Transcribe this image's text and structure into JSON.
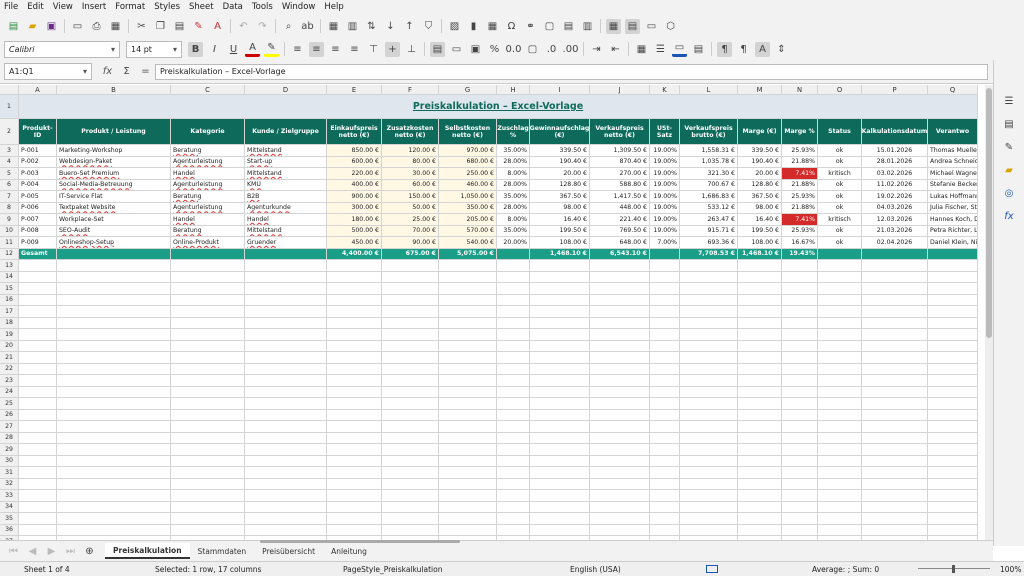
{
  "menu": [
    "File",
    "Edit",
    "View",
    "Insert",
    "Format",
    "Styles",
    "Sheet",
    "Data",
    "Tools",
    "Window",
    "Help"
  ],
  "toolbar": {
    "font_name": "Calibri",
    "font_size": "14 pt"
  },
  "formula_bar": {
    "name_box": "A1:Q1",
    "fx": "fx",
    "sigma": "Σ",
    "eq": "=",
    "content": "Preiskalkulation – Excel-Vorlage"
  },
  "columns": [
    "A",
    "B",
    "C",
    "D",
    "E",
    "F",
    "G",
    "H",
    "I",
    "J",
    "K",
    "L",
    "M",
    "N",
    "O",
    "P",
    "Q"
  ],
  "title": "Preiskalkulation – Excel-Vorlage",
  "headers": [
    "Produkt-ID",
    "Produkt / Leistung",
    "Kategorie",
    "Kunde / Zielgruppe",
    "Einkaufspreis netto (€)",
    "Zusatzkosten netto (€)",
    "Selbstkosten netto (€)",
    "Zuschlag %",
    "Gewinnaufschlag (€)",
    "Verkaufspreis netto (€)",
    "USt-Satz",
    "Verkaufspreis brutto (€)",
    "Marge (€)",
    "Marge %",
    "Status",
    "Kalkulationsdatum",
    "Verantwo"
  ],
  "rows": [
    [
      "P-001",
      "Marketing-Workshop",
      "Beratung",
      "Mittelstand",
      "850.00 €",
      "120.00 €",
      "970.00 €",
      "35.00%",
      "339.50 €",
      "1,309.50 €",
      "19.00%",
      "1,558.31 €",
      "339.50 €",
      "25.93%",
      "ok",
      "15.01.2026",
      "Thomas Mueller"
    ],
    [
      "P-002",
      "Webdesign-Paket",
      "Agenturleistung",
      "Start-up",
      "600.00 €",
      "80.00 €",
      "680.00 €",
      "28.00%",
      "190.40 €",
      "870.40 €",
      "19.00%",
      "1,035.78 €",
      "190.40 €",
      "21.88%",
      "ok",
      "28.01.2026",
      "Andrea Schneid"
    ],
    [
      "P-003",
      "Buero-Set Premium",
      "Handel",
      "Mittelstand",
      "220.00 €",
      "30.00 €",
      "250.00 €",
      "8.00%",
      "20.00 €",
      "270.00 €",
      "19.00%",
      "321.30 €",
      "20.00 €",
      "7.41%",
      "kritisch",
      "03.02.2026",
      "Michael Wagne"
    ],
    [
      "P-004",
      "Social-Media-Betreuung",
      "Agenturleistung",
      "KMU",
      "400.00 €",
      "60.00 €",
      "460.00 €",
      "28.00%",
      "128.80 €",
      "588.80 €",
      "19.00%",
      "700.67 €",
      "128.80 €",
      "21.88%",
      "ok",
      "11.02.2026",
      "Stefanie Becker"
    ],
    [
      "P-005",
      "IT-Service Flat",
      "Beratung",
      "B2B",
      "900.00 €",
      "150.00 €",
      "1,050.00 €",
      "35.00%",
      "367.50 €",
      "1,417.50 €",
      "19.00%",
      "1,686.83 €",
      "367.50 €",
      "25.93%",
      "ok",
      "19.02.2026",
      "Lukas Hoffmann"
    ],
    [
      "P-006",
      "Textpaket Website",
      "Agenturleistung",
      "Agenturkunde",
      "300.00 €",
      "50.00 €",
      "350.00 €",
      "28.00%",
      "98.00 €",
      "448.00 €",
      "19.00%",
      "533.12 €",
      "98.00 €",
      "21.88%",
      "ok",
      "04.03.2026",
      "Julia Fischer, St"
    ],
    [
      "P-007",
      "Workplace-Set",
      "Handel",
      "Handel",
      "180.00 €",
      "25.00 €",
      "205.00 €",
      "8.00%",
      "16.40 €",
      "221.40 €",
      "19.00%",
      "263.47 €",
      "16.40 €",
      "7.41%",
      "kritisch",
      "12.03.2026",
      "Hannes Koch, D"
    ],
    [
      "P-008",
      "SEO-Audit",
      "Beratung",
      "Mittelstand",
      "500.00 €",
      "70.00 €",
      "570.00 €",
      "35.00%",
      "199.50 €",
      "769.50 €",
      "19.00%",
      "915.71 €",
      "199.50 €",
      "25.93%",
      "ok",
      "21.03.2026",
      "Petra Richter, Le"
    ],
    [
      "P-009",
      "Onlineshop-Setup",
      "Online-Produkt",
      "Gruender",
      "450.00 €",
      "90.00 €",
      "540.00 €",
      "20.00%",
      "108.00 €",
      "648.00 €",
      "7.00%",
      "693.36 €",
      "108.00 €",
      "16.67%",
      "ok",
      "02.04.2026",
      "Daniel Klein, Ni"
    ]
  ],
  "total": [
    "Gesamt",
    "",
    "",
    "",
    "4,400.00 €",
    "675.00 €",
    "5,075.00 €",
    "",
    "1,468.10 €",
    "6,543.10 €",
    "",
    "7,708.53 €",
    "1,468.10 €",
    "19.43%",
    "",
    "",
    ""
  ],
  "row_numbers": [
    "1",
    "2",
    "3",
    "4",
    "5",
    "6",
    "7",
    "8",
    "9",
    "10",
    "11",
    "12",
    "13",
    "14",
    "15",
    "16",
    "17",
    "18",
    "19",
    "20",
    "21",
    "22",
    "23",
    "24",
    "25",
    "26",
    "27",
    "28",
    "29",
    "30",
    "31",
    "32",
    "33",
    "34",
    "35",
    "36",
    "37"
  ],
  "sheet_tabs": [
    "Preiskalkulation",
    "Stammdaten",
    "Preisübersicht",
    "Anleitung"
  ],
  "status": {
    "sheet": "Sheet 1 of 4",
    "selected": "Selected: 1 row, 17 columns",
    "page_style": "PageStyle_Preiskalkulation",
    "language": "English (USA)",
    "sum": "Average: ; Sum: 0",
    "zoom": "100%"
  }
}
